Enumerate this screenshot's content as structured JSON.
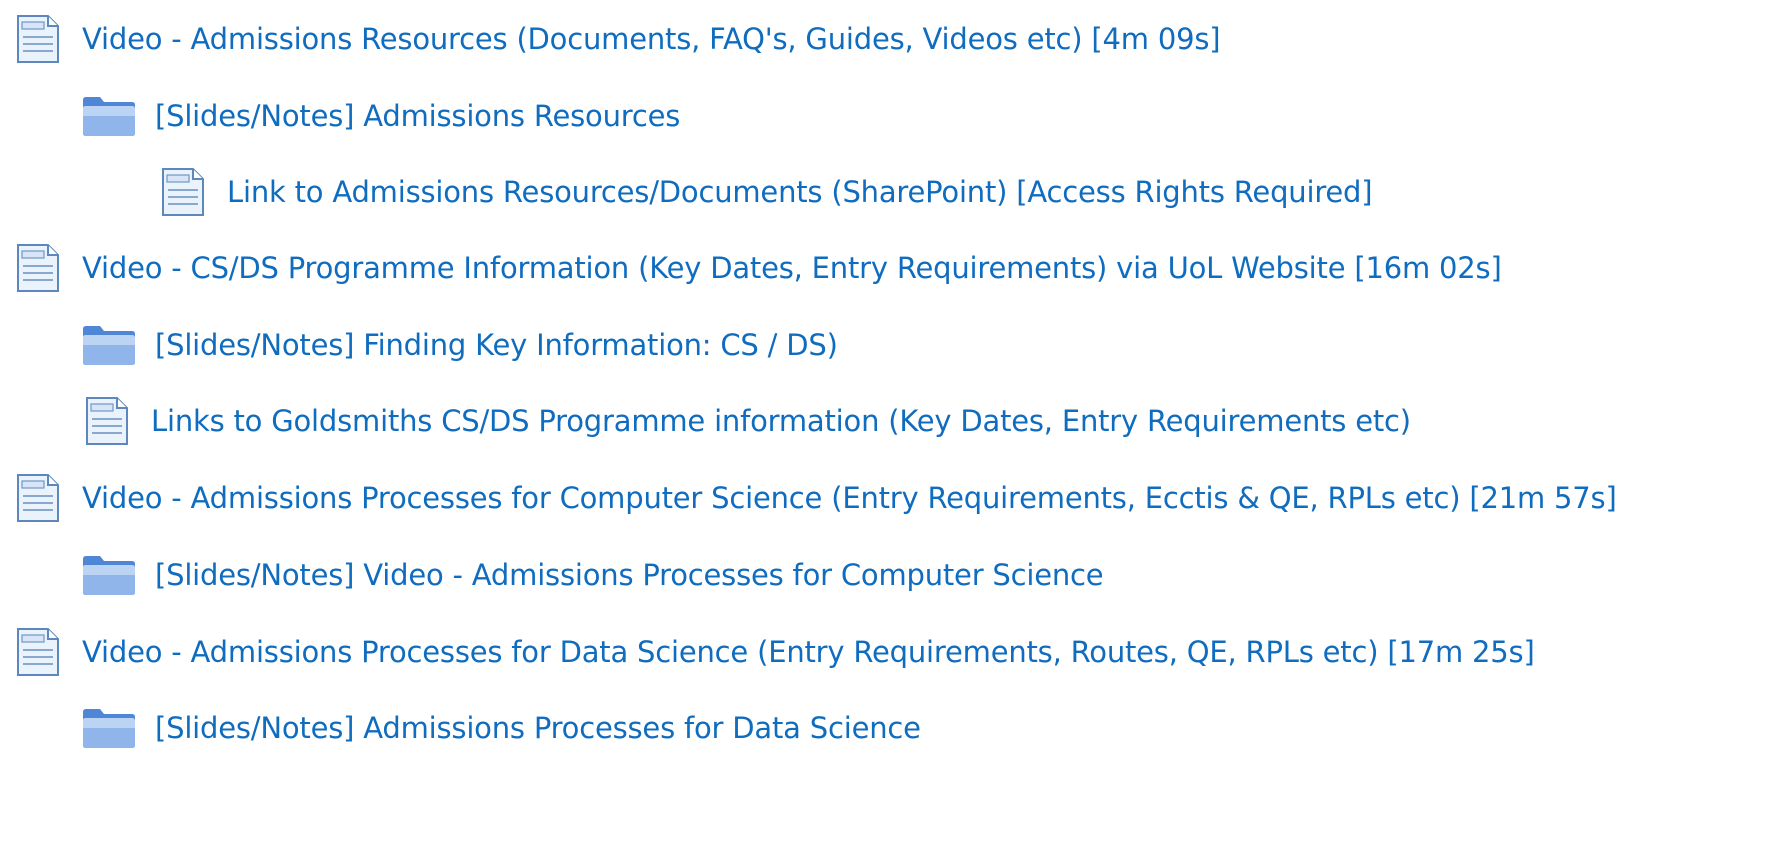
{
  "items": [
    {
      "type": "page",
      "level": 0,
      "label": "Video - Admissions Resources (Documents, FAQ's, Guides, Videos etc) [4m 09s]",
      "icon": "page-icon"
    },
    {
      "type": "folder",
      "level": 1,
      "label": "[Slides/Notes] Admissions Resources",
      "icon": "folder-icon"
    },
    {
      "type": "page",
      "level": 2,
      "label": "Link to Admissions Resources/Documents (SharePoint) [Access Rights Required]",
      "icon": "page-icon"
    },
    {
      "type": "page",
      "level": 0,
      "label": "Video - CS/DS Programme Information (Key Dates, Entry Requirements) via UoL Website [16m 02s]",
      "icon": "page-icon"
    },
    {
      "type": "folder",
      "level": 1,
      "label": "[Slides/Notes] Finding Key Information: CS / DS)",
      "icon": "folder-icon"
    },
    {
      "type": "page",
      "level": 1,
      "label": "Links to Goldsmiths CS/DS Programme information (Key Dates, Entry Requirements etc)",
      "icon": "page-icon"
    },
    {
      "type": "page",
      "level": 0,
      "label": "Video - Admissions Processes for Computer Science (Entry Requirements, Ecctis & QE, RPLs etc) [21m 57s]",
      "icon": "page-icon"
    },
    {
      "type": "folder",
      "level": 1,
      "label": "[Slides/Notes] Video - Admissions Processes for Computer Science",
      "icon": "folder-icon"
    },
    {
      "type": "page",
      "level": 0,
      "label": "Video - Admissions Processes for Data Science (Entry Requirements, Routes, QE, RPLs etc) [17m 25s]",
      "icon": "page-icon"
    },
    {
      "type": "folder",
      "level": 1,
      "label": "[Slides/Notes] Admissions Processes for Data Science",
      "icon": "folder-icon"
    }
  ],
  "colors": {
    "link": "#0f6cbf",
    "folder_light": "#aac8f0",
    "folder_dark": "#4f86d6",
    "page_stroke": "#5d87bd",
    "page_fill": "#eaf2fb"
  }
}
